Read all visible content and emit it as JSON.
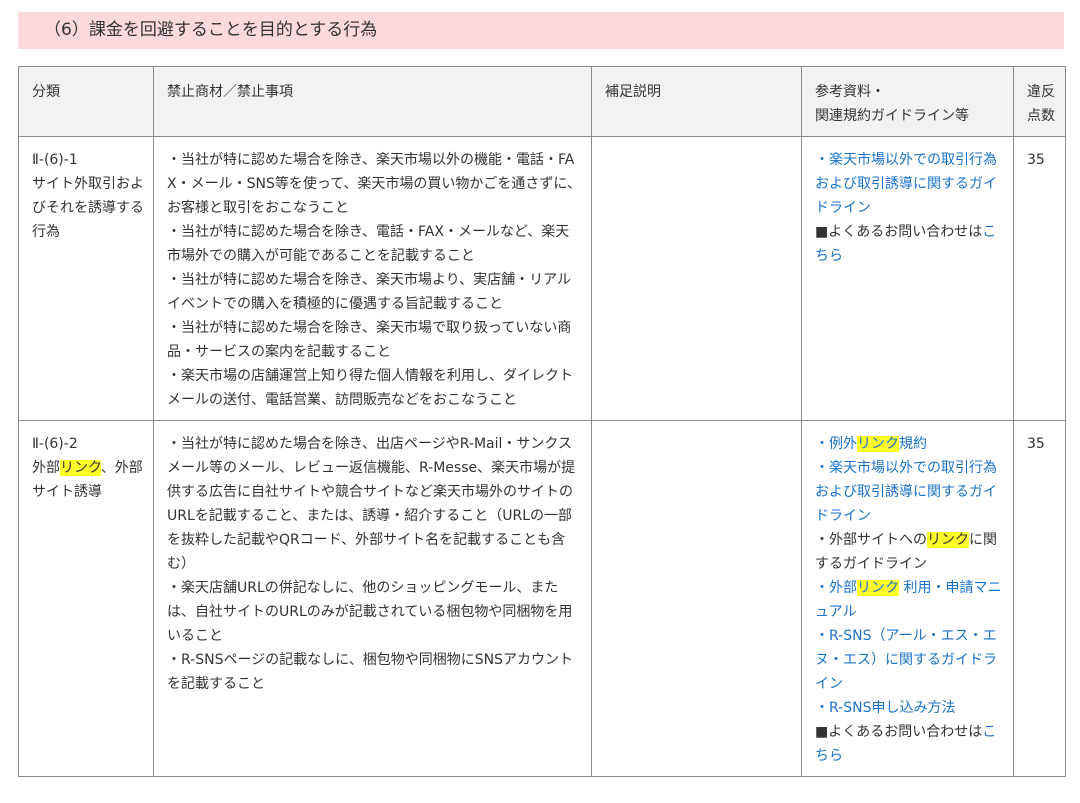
{
  "section": {
    "title": "（6）課金を回避することを目的とする行為"
  },
  "table": {
    "headers": {
      "category": "分類",
      "prohibited": "禁止商材／禁止事項",
      "supplement": "補足説明",
      "references_line1": "参考資料・",
      "references_line2": "関連規約ガイドライン等",
      "points_line1": "違反",
      "points_line2": "点数"
    },
    "rows": [
      {
        "id": "Ⅱ-(6)-1",
        "category_name": "サイト外取引およびそれを誘導する行為",
        "items": [
          "・当社が特に認めた場合を除き、楽天市場以外の機能・電話・FAX・メール・SNS等を使って、楽天市場の買い物かごを通さずに、お客様と取引をおこなうこと",
          "・当社が特に認めた場合を除き、電話・FAX・メールなど、楽天市場外での購入が可能であることを記載すること",
          "・当社が特に認めた場合を除き、楽天市場より、実店舗・リアルイベントでの購入を積極的に優遇する旨記載すること",
          "・当社が特に認めた場合を除き、楽天市場で取り扱っていない商品・サービスの案内を記載すること",
          "・楽天市場の店舗運営上知り得た個人情報を利用し、ダイレクトメールの送付、電話営業、訪問販売などをおこなうこと"
        ],
        "supplement": "",
        "references": {
          "ref1_prefix": "・",
          "ref1_link": "楽天市場以外での取引行為および取引誘導に関するガイドライン",
          "faq_text": "■よくあるお問い合わせは",
          "faq_link": "こちら"
        },
        "points": "35"
      },
      {
        "id": "Ⅱ-(6)-2",
        "category_name_part1": "外部",
        "category_name_hl": "リンク",
        "category_name_part2": "、外部サイト誘導",
        "items": [
          "・当社が特に認めた場合を除き、出店ページやR-Mail・サンクスメール等のメール、レビュー返信機能、R-Messe、楽天市場が提供する広告に自社サイトや競合サイトなど楽天市場外のサイトのURLを記載すること、または、誘導・紹介すること（URLの一部を抜粋した記載やQRコード、外部サイト名を記載することも含む）",
          "・楽天店舗URLの併記なしに、他のショッピングモール、または、自社サイトのURLのみが記載されている梱包物や同梱物を用いること",
          "・R-SNSページの記載なしに、梱包物や同梱物にSNSアカウントを記載すること"
        ],
        "supplement": "",
        "references": {
          "r1_prefix": "・",
          "r1_pre": "例外",
          "r1_hl": "リンク",
          "r1_post": "規約",
          "r2_prefix": "・",
          "r2_link": "楽天市場以外での取引行為および取引誘導に関するガイドライン",
          "r3_pre": "・外部サイトへの",
          "r3_hl": "リンク",
          "r3_post": "に関するガイドライン",
          "r4_prefix": "・",
          "r4_pre": "外部",
          "r4_hl": "リンク",
          "r4_post": " 利用・申請マニュアル",
          "r5_prefix": "・",
          "r5_link": "R-SNS（アール・エス・エヌ・エス）に関するガイドライン",
          "r6_prefix": "・",
          "r6_link": "R-SNS申し込み方法",
          "faq_text": "■よくあるお問い合わせは",
          "faq_link": "こちら"
        },
        "points": "35"
      }
    ]
  },
  "colors": {
    "header_band": "#fcd9dd",
    "table_head_bg": "#f2f2f2",
    "link": "#1a73c9",
    "highlight": "#ffff2a",
    "border": "#8c8c8c"
  }
}
